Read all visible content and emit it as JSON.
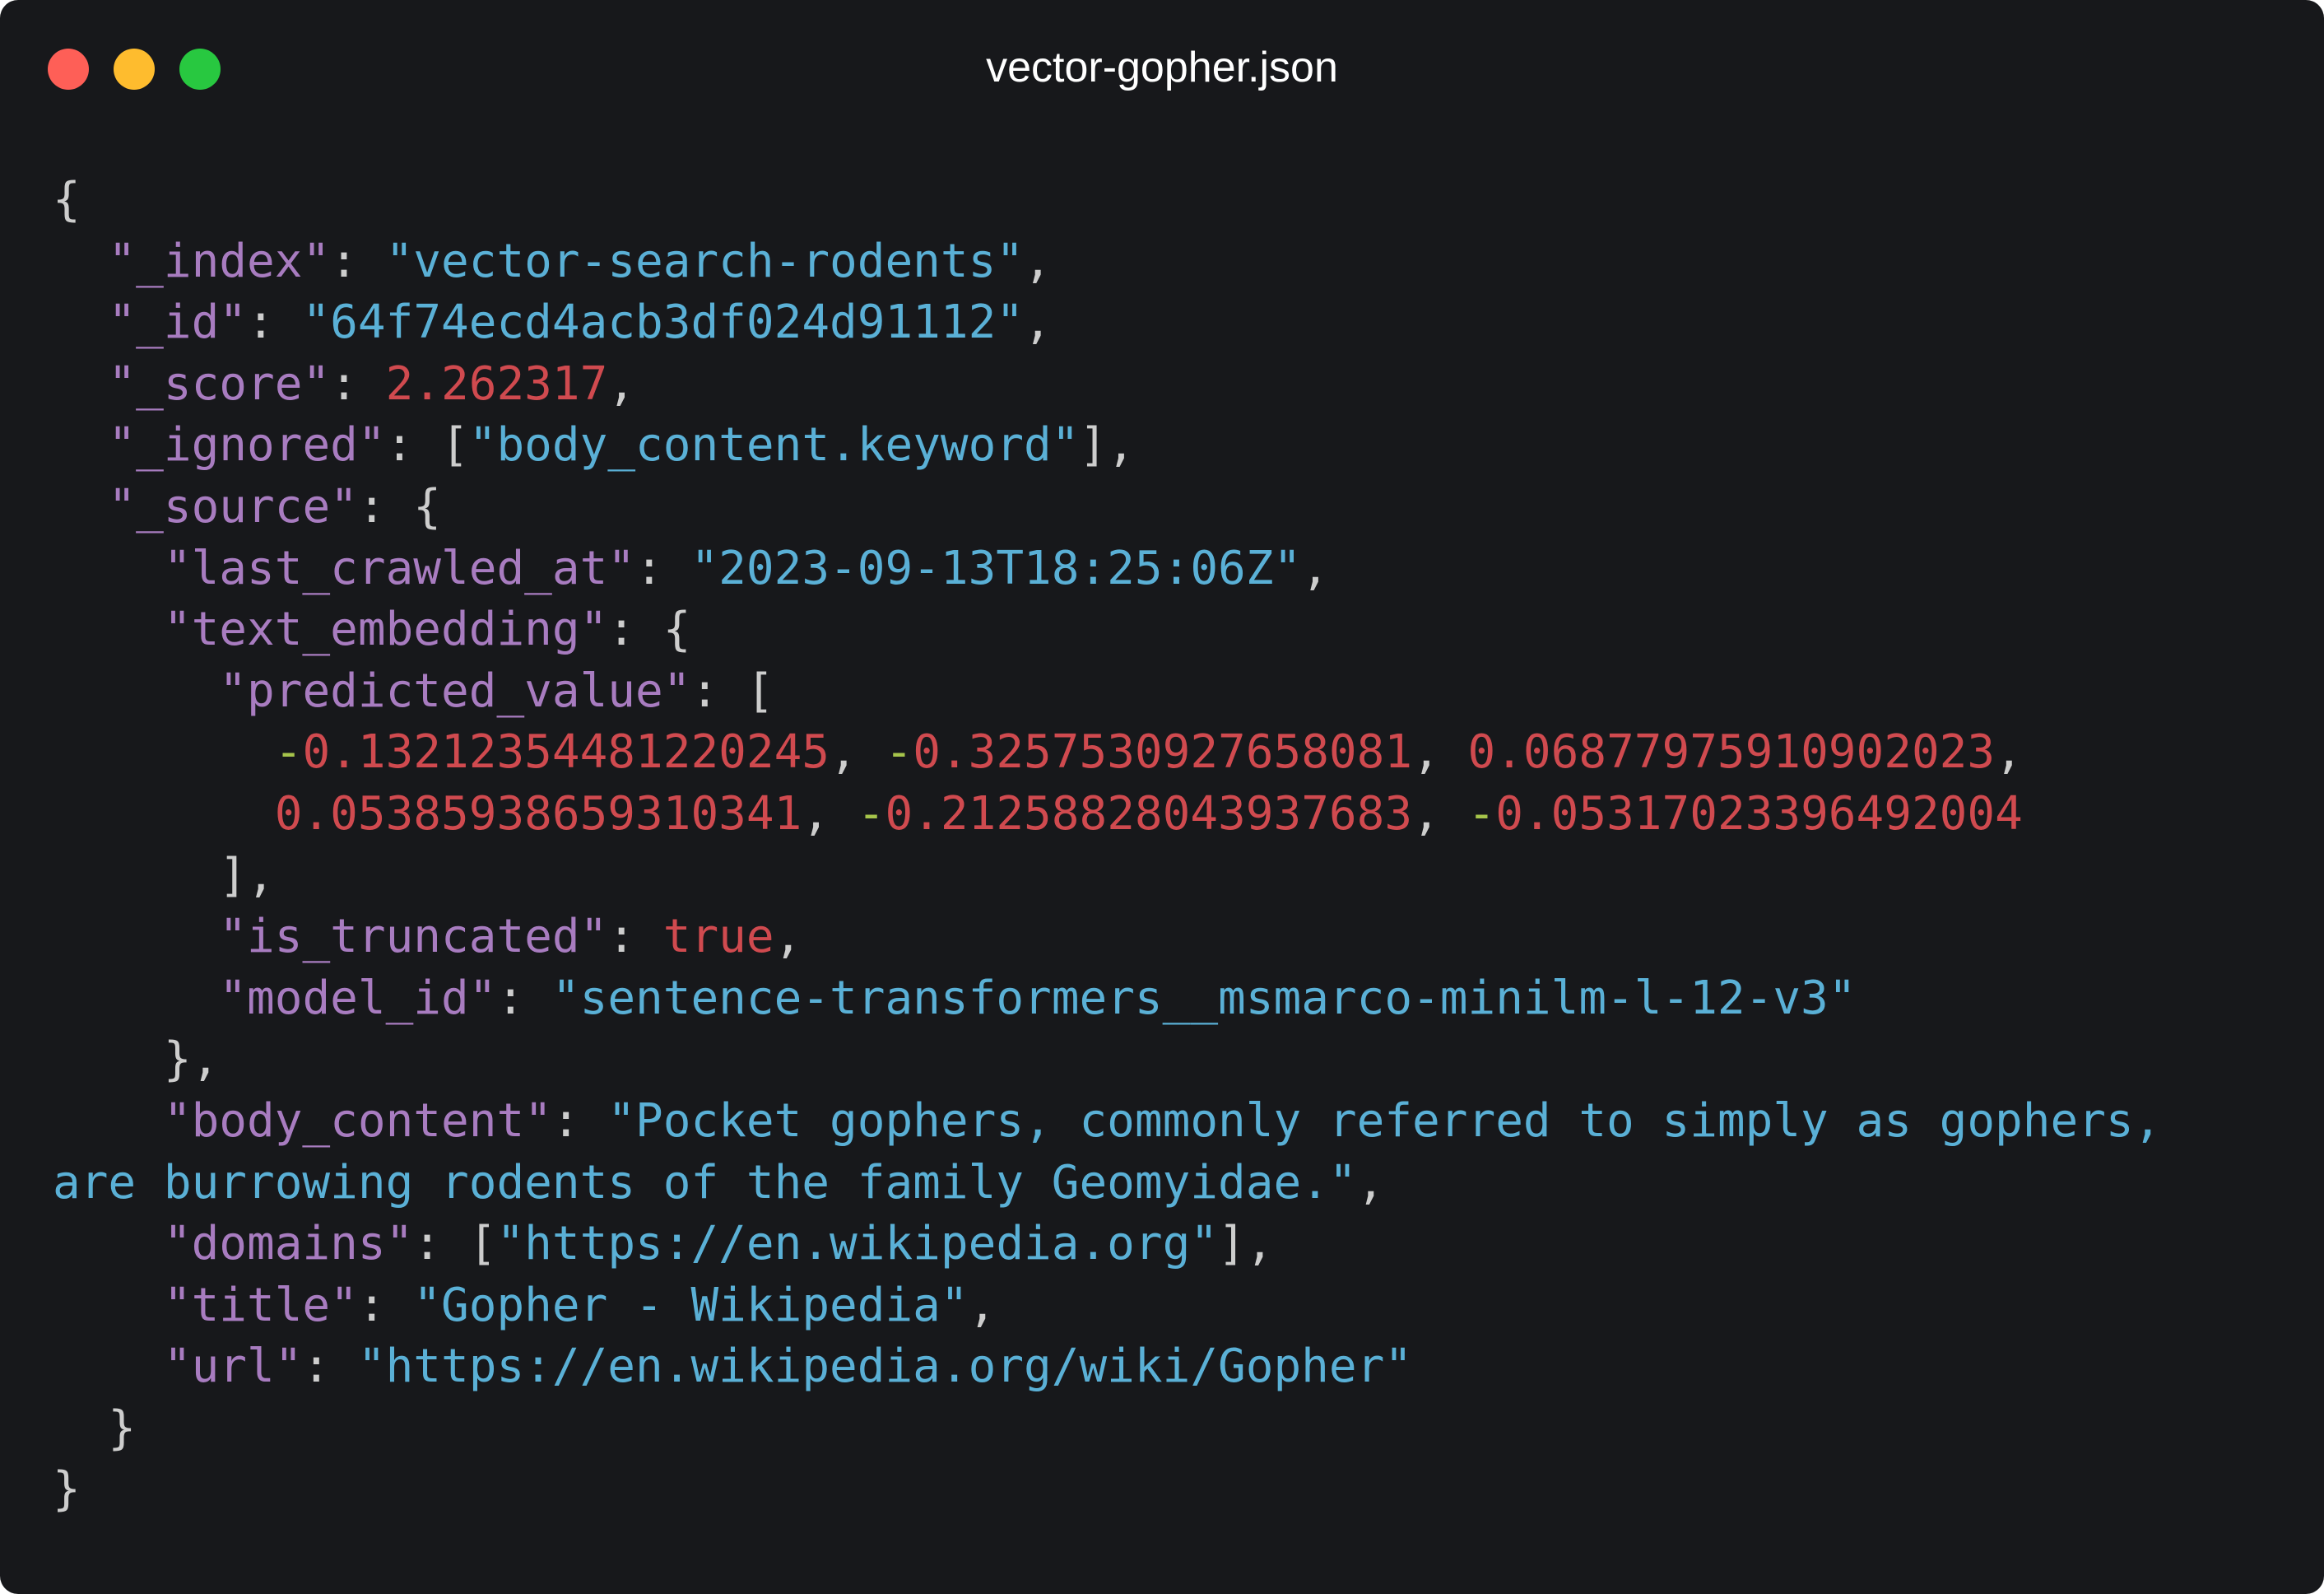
{
  "window": {
    "title": "vector-gopher.json"
  },
  "json": {
    "key_index": "\"_index\"",
    "val_index": "\"vector-search-rodents\"",
    "key_id": "\"_id\"",
    "val_id": "\"64f74ecd4acb3df024d91112\"",
    "key_score": "\"_score\"",
    "val_score": "2.262317",
    "key_ignored": "\"_ignored\"",
    "val_ignored": "\"body_content.keyword\"",
    "key_source": "\"_source\"",
    "key_last_crawled_at": "\"last_crawled_at\"",
    "val_last_crawled_at": "\"2023-09-13T18:25:06Z\"",
    "key_text_embedding": "\"text_embedding\"",
    "key_predicted_value": "\"predicted_value\"",
    "pv1": "0.13212354481220245",
    "pv2": "0.3257530927658081",
    "pv3": "0.06877975910902023",
    "pv4": "0.05385938659310341",
    "pv5": "0.21258828043937683",
    "pv6": "0.05317023396492004",
    "key_is_truncated": "\"is_truncated\"",
    "val_is_truncated": "true",
    "key_model_id": "\"model_id\"",
    "val_model_id": "\"sentence-transformers__msmarco-minilm-l-12-v3\"",
    "key_body_content": "\"body_content\"",
    "val_body_content_1": "\"Pocket gophers, commonly referred to simply as gophers,",
    "val_body_content_2": "are burrowing rodents of the family Geomyidae.\"",
    "key_domains": "\"domains\"",
    "val_domains": "\"https://en.wikipedia.org\"",
    "key_title": "\"title\"",
    "val_title": "\"Gopher - Wikipedia\"",
    "key_url": "\"url\"",
    "val_url": "\"https://en.wikipedia.org/wiki/Gopher\""
  },
  "colors": {
    "background": "#17181b",
    "key": "#a87cc0",
    "string": "#5ab0d6",
    "number": "#d04a4f",
    "minus_sign": "#a6c44b",
    "punctuation": "#cdcdcd"
  }
}
